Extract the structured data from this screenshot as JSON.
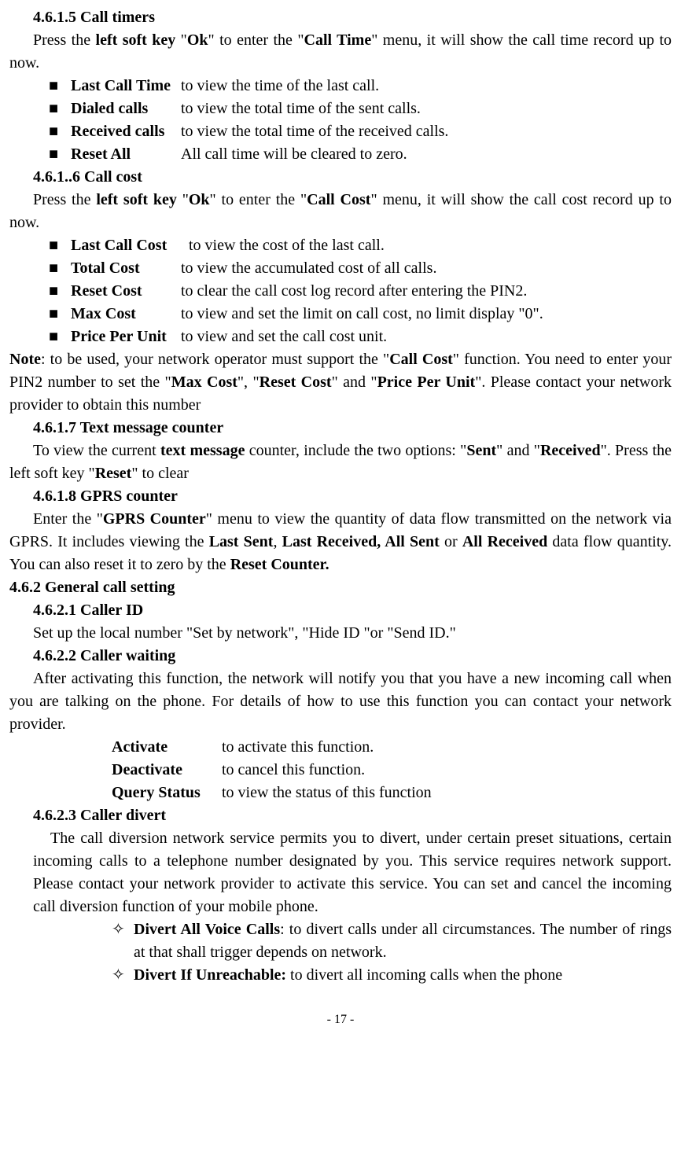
{
  "s1": {
    "heading": "4.6.1.5 Call timers",
    "para_parts": [
      "Press the ",
      "left soft key",
      " \"",
      "Ok",
      "\" to enter the \"",
      "Call Time",
      "\" menu, it will show the call time record up to now."
    ],
    "items": [
      {
        "label": "Last Call Time",
        "desc": "to view the time of the last call."
      },
      {
        "label": "Dialed calls",
        "desc": "to view the total time of the sent calls."
      },
      {
        "label": "Received calls",
        "desc": "to view the total time of the received calls."
      },
      {
        "label": "Reset All",
        "desc": "All call time will be cleared to zero."
      }
    ]
  },
  "s2": {
    "heading": "4.6.1..6 Call cost",
    "para_parts": [
      "Press the ",
      "left soft key",
      " \"",
      "Ok",
      "\" to enter the \"",
      "Call Cost",
      "\" menu, it will show the call cost record up to now."
    ],
    "items": [
      {
        "label": "Last Call Cost",
        "desc": "to view the cost of the last call."
      },
      {
        "label": "Total Cost",
        "desc": "to view the accumulated cost of all calls."
      },
      {
        "label": "Reset Cost",
        "desc": "to clear the call cost log record after entering the PIN2."
      },
      {
        "label": "Max Cost",
        "desc": "to view and set the limit on call cost, no limit display \"0\"."
      },
      {
        "label": "Price Per Unit",
        "desc": "to view and set the call cost unit."
      }
    ],
    "note_parts": [
      "Note",
      ":   to be used, your network operator must support the \"",
      "Call Cost",
      "\" function. You need to enter your PIN2 number to set the \"",
      "Max Cost",
      "\", \"",
      "Reset Cost",
      "\" and \"",
      "Price Per Unit",
      "\". Please contact your network provider to obtain this number"
    ]
  },
  "s3": {
    "heading": "4.6.1.7 Text message counter",
    "para_parts": [
      "To view the current ",
      "text message",
      " counter, include the two options: \"",
      "Sent",
      "\" and \"",
      "Received",
      "\". Press the left soft key \"",
      "Reset",
      "\" to clear"
    ]
  },
  "s4": {
    "heading": "4.6.1.8 GPRS counter",
    "para_parts": [
      "Enter the \"",
      "GPRS Counter",
      "\" menu to view the quantity of data flow transmitted on the network via GPRS. It includes viewing the ",
      "Last Sent",
      ", ",
      "Last Received, All Sent",
      " or ",
      "All Received",
      " data flow quantity. You can also reset it to zero by the ",
      "Reset Counter."
    ]
  },
  "s5": {
    "heading": "4.6.2 General call setting"
  },
  "s6": {
    "heading": "4.6.2.1 Caller ID",
    "para": "Set up the local number \"Set by network\", \"Hide ID \"or \"Send ID.\""
  },
  "s7": {
    "heading": "4.6.2.2 Caller waiting",
    "para": "After activating this function, the network will notify you that you have a new incoming call when you are talking on the phone. For details of how to use this function you can contact your network provider.",
    "opts": [
      {
        "label": "Activate",
        "desc": "to activate this function."
      },
      {
        "label": "Deactivate",
        "desc": "to cancel this function."
      },
      {
        "label": "Query Status",
        "desc": "to view the status of this function"
      }
    ]
  },
  "s8": {
    "heading": "4.6.2.3 Caller divert",
    "para": "The call diversion network service permits you to divert, under certain preset situations, certain incoming calls to a telephone number designated by you. This service requires network support. Please contact your network provider to activate this service. You can set and cancel the incoming call diversion function of your mobile phone.",
    "diamonds": [
      {
        "bold": "Divert All Voice Calls",
        "rest": ": to divert calls under all circumstances. The number of rings at that shall trigger depends on network."
      },
      {
        "bold": "Divert If Unreachable:",
        "rest": " to divert all incoming calls when the phone"
      }
    ]
  },
  "footer": "- 17 -",
  "markers": {
    "square": "■",
    "diamond": "✧"
  }
}
